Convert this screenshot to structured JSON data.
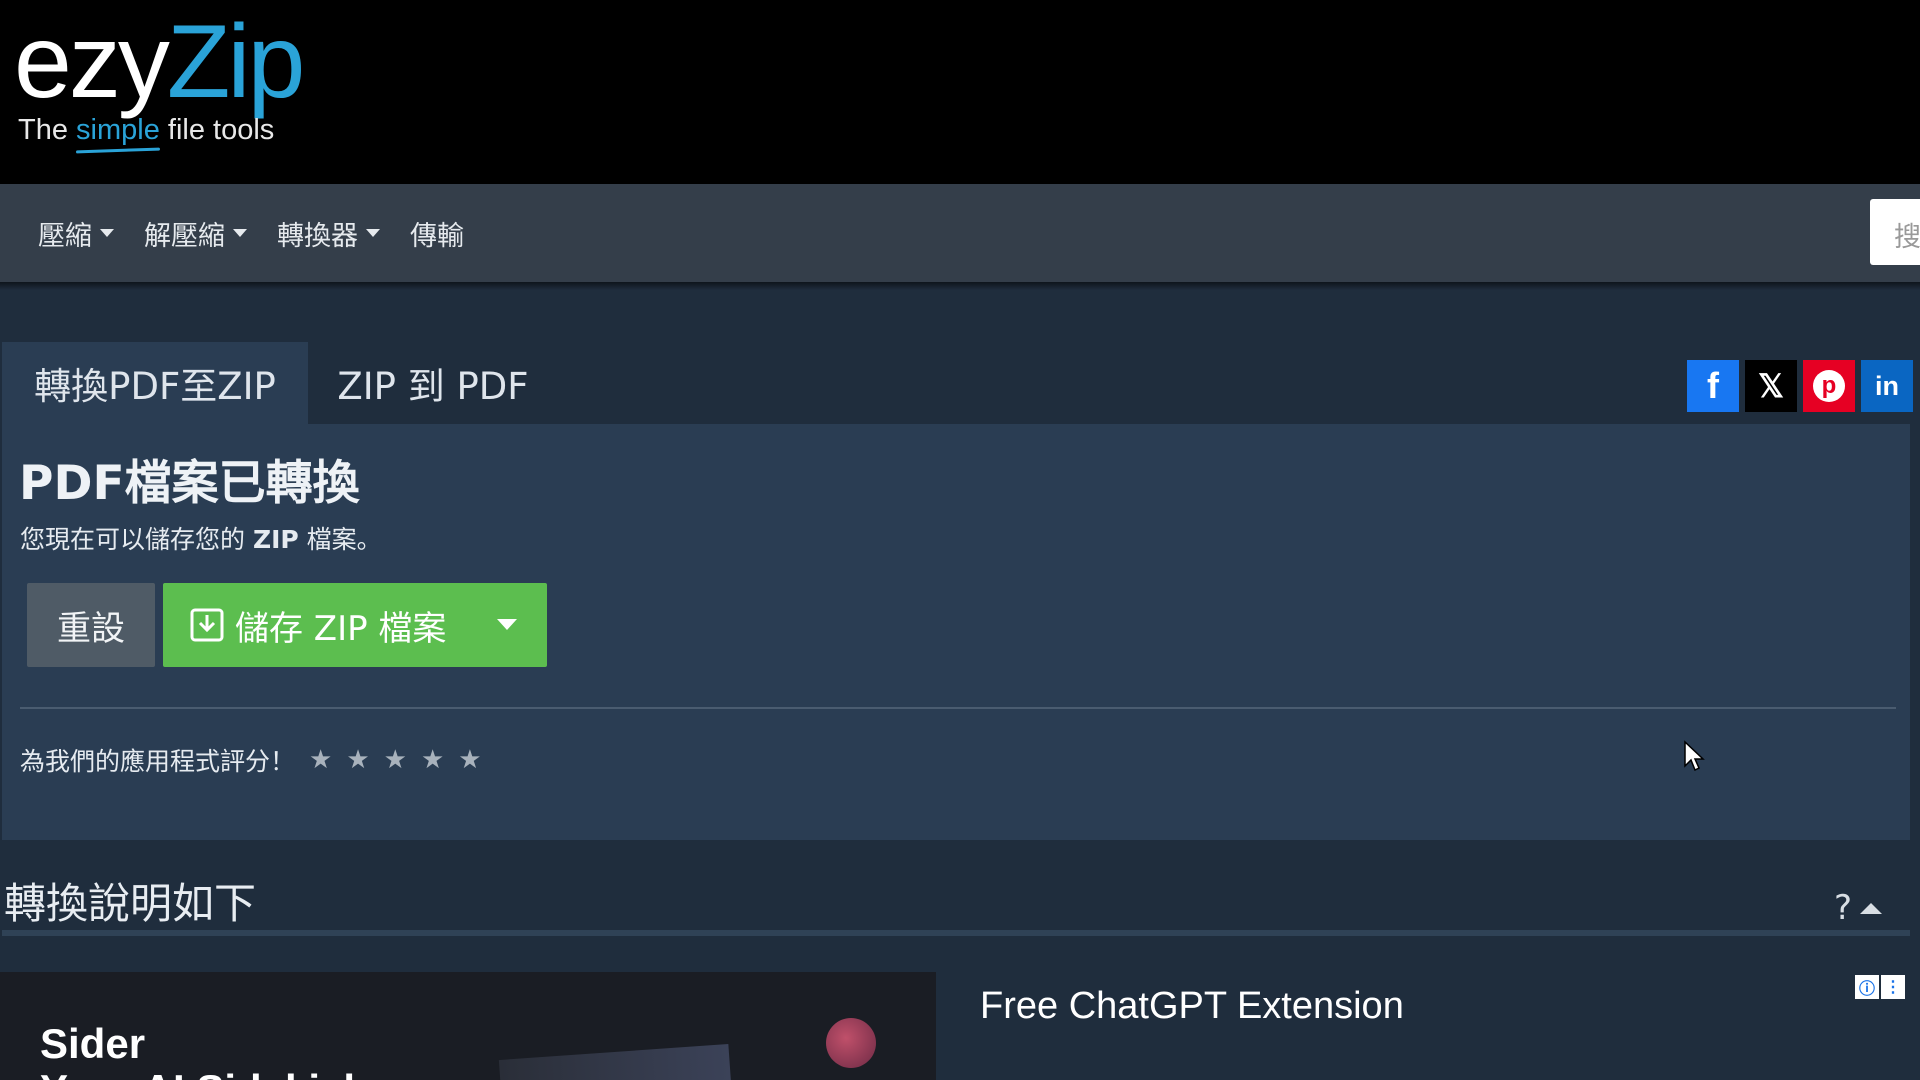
{
  "logo": {
    "wordmark_a": "ezy",
    "wordmark_b": "Zip",
    "tagline_a": "The ",
    "tagline_b": "simple",
    "tagline_c": " file tools"
  },
  "nav": {
    "items": [
      {
        "label": "壓縮",
        "has_dropdown": true
      },
      {
        "label": "解壓縮",
        "has_dropdown": true
      },
      {
        "label": "轉換器",
        "has_dropdown": true
      },
      {
        "label": "傳輸",
        "has_dropdown": false
      }
    ],
    "search_placeholder": "搜"
  },
  "tabs": {
    "active": "轉換PDF至ZIP",
    "other": "ZIP 到 PDF"
  },
  "share": {
    "facebook": "f",
    "x": "𝕏",
    "pinterest": "p",
    "linkedin": "in"
  },
  "panel": {
    "title": "PDF檔案已轉換",
    "subtitle_a": "您現在可以儲存您的 ",
    "subtitle_b": "ZIP",
    "subtitle_c": " 檔案。",
    "reset_label": "重設",
    "save_label": "儲存 ZIP 檔案",
    "rating_label": "為我們的應用程式評分！",
    "stars": [
      "★",
      "★",
      "★",
      "★",
      "★"
    ],
    "rating_value": 0
  },
  "instructions": {
    "title": "轉換說明如下",
    "toggle": "?"
  },
  "ad": {
    "brand": "Sider",
    "subline": "Your AI Sidekick",
    "headline": "Free ChatGPT Extension",
    "info_icon": "ⓘ",
    "menu_icon": "⋮"
  },
  "colors": {
    "header_bg": "#000000",
    "nav_bg": "#343e4a",
    "page_bg": "#1f2d3d",
    "panel_bg": "#2a3d53",
    "accent_blue": "#2aa3d8",
    "save_green": "#5cbe4f",
    "reset_gray": "#4f5b66"
  }
}
